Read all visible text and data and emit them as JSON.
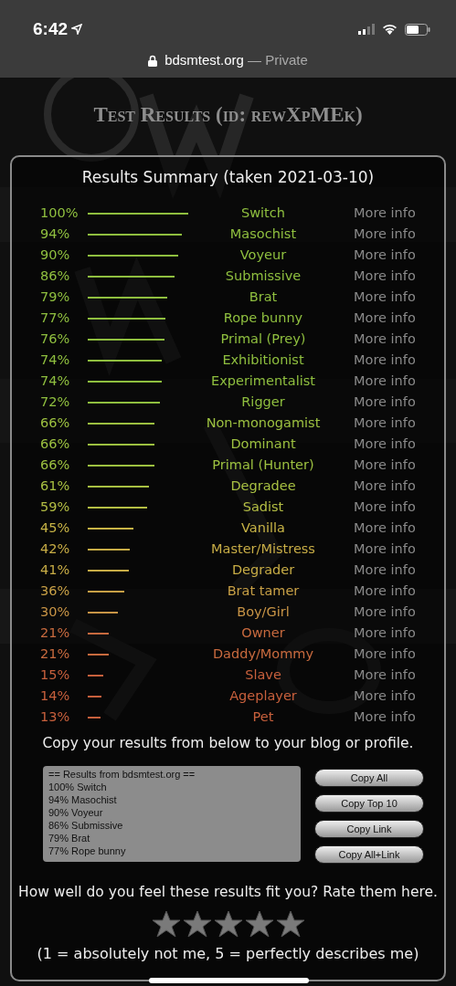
{
  "status_bar": {
    "time": "6:42"
  },
  "address_bar": {
    "domain": "bdsmtest.org",
    "mode": "— Private"
  },
  "title": "Test Results (id: rewXpMEk)",
  "summary": {
    "title": "Results Summary (taken 2021-03-10)",
    "results": [
      {
        "percent": "100%",
        "name": "Switch",
        "color": "#8fbf3f",
        "link": "More info"
      },
      {
        "percent": "94%",
        "name": "Masochist",
        "color": "#8fbf3f",
        "link": "More info"
      },
      {
        "percent": "90%",
        "name": "Voyeur",
        "color": "#8fbf3f",
        "link": "More info"
      },
      {
        "percent": "86%",
        "name": "Submissive",
        "color": "#8fbf3f",
        "link": "More info"
      },
      {
        "percent": "79%",
        "name": "Brat",
        "color": "#8fbf3f",
        "link": "More info"
      },
      {
        "percent": "77%",
        "name": "Rope bunny",
        "color": "#8fbf3f",
        "link": "More info"
      },
      {
        "percent": "76%",
        "name": "Primal (Prey)",
        "color": "#8fbf3f",
        "link": "More info"
      },
      {
        "percent": "74%",
        "name": "Exhibitionist",
        "color": "#8fbf3f",
        "link": "More info"
      },
      {
        "percent": "74%",
        "name": "Experimentalist",
        "color": "#8fbf3f",
        "link": "More info"
      },
      {
        "percent": "72%",
        "name": "Rigger",
        "color": "#8fbf3f",
        "link": "More info"
      },
      {
        "percent": "66%",
        "name": "Non-monogamist",
        "color": "#9cc040",
        "link": "More info"
      },
      {
        "percent": "66%",
        "name": "Dominant",
        "color": "#9cc040",
        "link": "More info"
      },
      {
        "percent": "66%",
        "name": "Primal (Hunter)",
        "color": "#9cc040",
        "link": "More info"
      },
      {
        "percent": "61%",
        "name": "Degradee",
        "color": "#a8c042",
        "link": "More info"
      },
      {
        "percent": "59%",
        "name": "Sadist",
        "color": "#b4be44",
        "link": "More info"
      },
      {
        "percent": "45%",
        "name": "Vanilla",
        "color": "#c8b446",
        "link": "More info"
      },
      {
        "percent": "42%",
        "name": "Master/Mistress",
        "color": "#c8ad46",
        "link": "More info"
      },
      {
        "percent": "41%",
        "name": "Degrader",
        "color": "#c8ad46",
        "link": "More info"
      },
      {
        "percent": "36%",
        "name": "Brat tamer",
        "color": "#c8a046",
        "link": "More info"
      },
      {
        "percent": "30%",
        "name": "Boy/Girl",
        "color": "#c89446",
        "link": "More info"
      },
      {
        "percent": "21%",
        "name": "Owner",
        "color": "#c86a3e",
        "link": "More info"
      },
      {
        "percent": "21%",
        "name": "Daddy/Mommy",
        "color": "#c86a3e",
        "link": "More info"
      },
      {
        "percent": "15%",
        "name": "Slave",
        "color": "#c8603c",
        "link": "More info"
      },
      {
        "percent": "14%",
        "name": "Ageplayer",
        "color": "#c8603c",
        "link": "More info"
      },
      {
        "percent": "13%",
        "name": "Pet",
        "color": "#c8603c",
        "link": "More info"
      }
    ]
  },
  "copy_prompt": "Copy your results from below to your blog or profile.",
  "export": {
    "lines": [
      "== Results from bdsmtest.org ==",
      "100% Switch",
      "94% Masochist",
      "90% Voyeur",
      "86% Submissive",
      "79% Brat",
      "77% Rope bunny"
    ],
    "buttons": [
      "Copy All",
      "Copy Top 10",
      "Copy Link",
      "Copy All+Link"
    ]
  },
  "rating": {
    "prompt": "How well do you feel these results fit you? Rate them here.",
    "legend": "(1 = absolutely not me, 5 = perfectly describes me)"
  }
}
